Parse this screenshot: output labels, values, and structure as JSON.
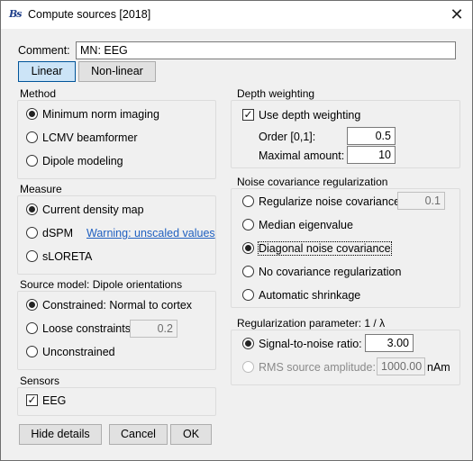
{
  "window": {
    "logo_text": "Bs",
    "title": "Compute sources [2018]",
    "close_glyph": "✕"
  },
  "comment": {
    "label": "Comment:",
    "value": "MN: EEG"
  },
  "mode_buttons": {
    "linear": "Linear",
    "nonlinear": "Non-linear",
    "selected": "linear"
  },
  "method": {
    "title": "Method",
    "options": [
      "Minimum norm imaging",
      "LCMV beamformer",
      "Dipole modeling"
    ],
    "selected": 0
  },
  "measure": {
    "title": "Measure",
    "options": [
      "Current density map",
      "dSPM",
      "sLORETA"
    ],
    "selected": 0,
    "warning_link": "Warning: unscaled values"
  },
  "source_model": {
    "title": "Source model: Dipole orientations",
    "options": [
      "Constrained:  Normal to cortex",
      "Loose constraints",
      "Unconstrained"
    ],
    "selected": 0,
    "loose_value": "0.2"
  },
  "sensors": {
    "title": "Sensors",
    "eeg_label": "EEG",
    "eeg_checked": true
  },
  "depth": {
    "title": "Depth weighting",
    "use_label": "Use depth weighting",
    "use_checked": true,
    "order_label": "Order [0,1]:",
    "order_value": "0.5",
    "max_label": "Maximal amount:",
    "max_value": "10"
  },
  "noise": {
    "title": "Noise covariance regularization",
    "options": [
      "Regularize noise covariance:",
      "Median eigenvalue",
      "Diagonal noise covariance",
      "No covariance regularization",
      "Automatic shrinkage"
    ],
    "selected": 2,
    "regularize_value": "0.1"
  },
  "regularization": {
    "title": "Regularization parameter: 1 / λ",
    "snr_label": "Signal-to-noise ratio:",
    "snr_value": "3.00",
    "snr_selected": true,
    "rms_label": "RMS source amplitude:",
    "rms_value": "1000.00",
    "rms_unit": "nAm"
  },
  "footer": {
    "hide_details": "Hide details",
    "cancel": "Cancel",
    "ok": "OK"
  }
}
